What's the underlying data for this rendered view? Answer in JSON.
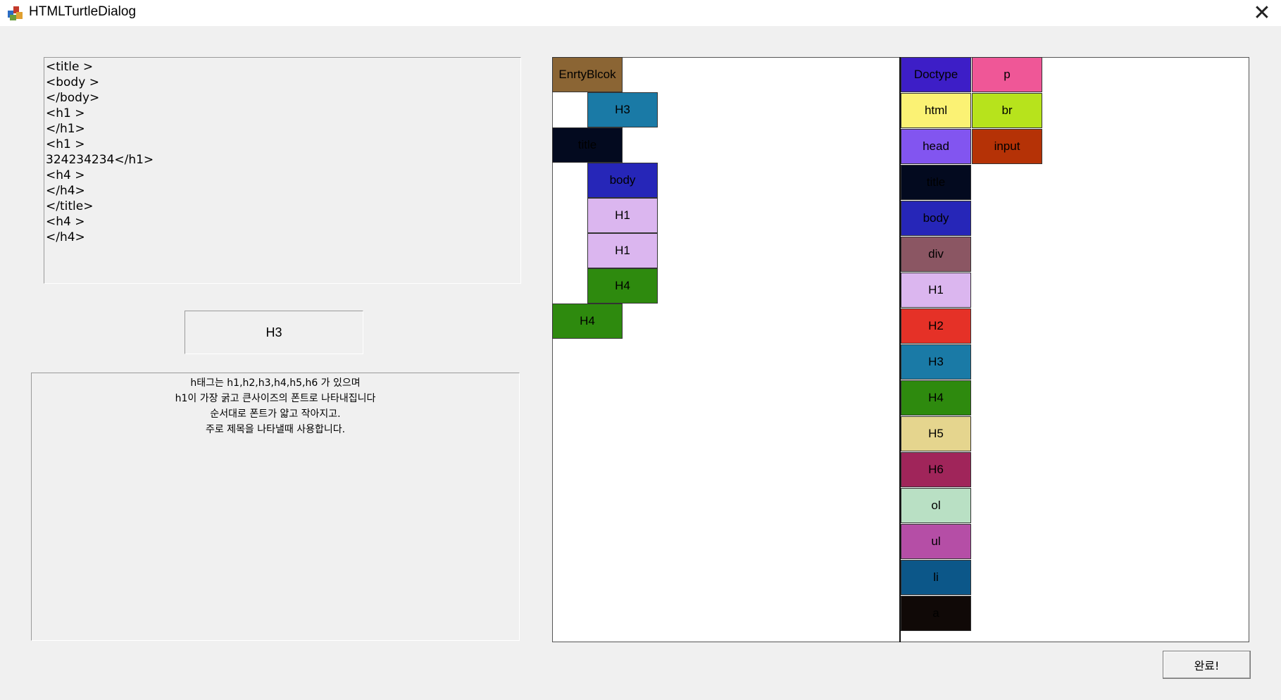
{
  "window": {
    "title": "HTMLTurtleDialog",
    "close_icon": "close-icon",
    "app_icon": "turtle-app-icon"
  },
  "code_editor": {
    "text": "<title >\n<body >\n</body>\n<h1 >\n</h1>\n<h1 >\n324234234</h1>\n<h4 >\n</h4>\n</title>\n<h4 >\n</h4>"
  },
  "selected_block": {
    "label": "H3"
  },
  "description": {
    "lines": [
      "h태그는 h1,h2,h3,h4,h5,h6 가 있으며",
      "h1이 가장 굵고 큰사이즈의 폰트로 나타내집니다",
      "순서대로 폰트가 얇고 작아지고.",
      "주로 제목을 나타낼때 사용합니다."
    ]
  },
  "workspace_blocks": [
    {
      "label": "EnrtyBlcok",
      "color": "#8b6534"
    },
    {
      "label": "H3",
      "color": "#1a7aa6"
    },
    {
      "label": "title",
      "color": "#030a1f"
    },
    {
      "label": "body",
      "color": "#2626b8"
    },
    {
      "label": "H1",
      "color": "#dbb6ef"
    },
    {
      "label": "H1",
      "color": "#dbb6ef"
    },
    {
      "label": "H4",
      "color": "#2e8a0e"
    },
    {
      "label": "H4",
      "color": "#2e8a0e"
    }
  ],
  "palette": {
    "col1": [
      {
        "label": "Doctype",
        "color": "#3d1ec7"
      },
      {
        "label": "html",
        "color": "#fbf274"
      },
      {
        "label": "head",
        "color": "#8255f0"
      },
      {
        "label": "title",
        "color": "#030a1f"
      },
      {
        "label": "body",
        "color": "#2626b8"
      },
      {
        "label": "div",
        "color": "#8b5663"
      },
      {
        "label": "H1",
        "color": "#dbb6ef"
      },
      {
        "label": "H2",
        "color": "#e53127"
      },
      {
        "label": "H3",
        "color": "#1a7aa6"
      },
      {
        "label": "H4",
        "color": "#2e8a0e"
      },
      {
        "label": "H5",
        "color": "#e5d58e"
      },
      {
        "label": "H6",
        "color": "#a0255a"
      },
      {
        "label": "ol",
        "color": "#b9e0c4"
      },
      {
        "label": "ul",
        "color": "#b54ea6"
      },
      {
        "label": "li",
        "color": "#0c5789"
      },
      {
        "label": "a",
        "color": "#100907"
      }
    ],
    "col2": [
      {
        "label": "p",
        "color": "#ef5797"
      },
      {
        "label": "br",
        "color": "#b7e31c"
      },
      {
        "label": "input",
        "color": "#b53206"
      }
    ]
  },
  "done_button": {
    "label": "완료!"
  }
}
